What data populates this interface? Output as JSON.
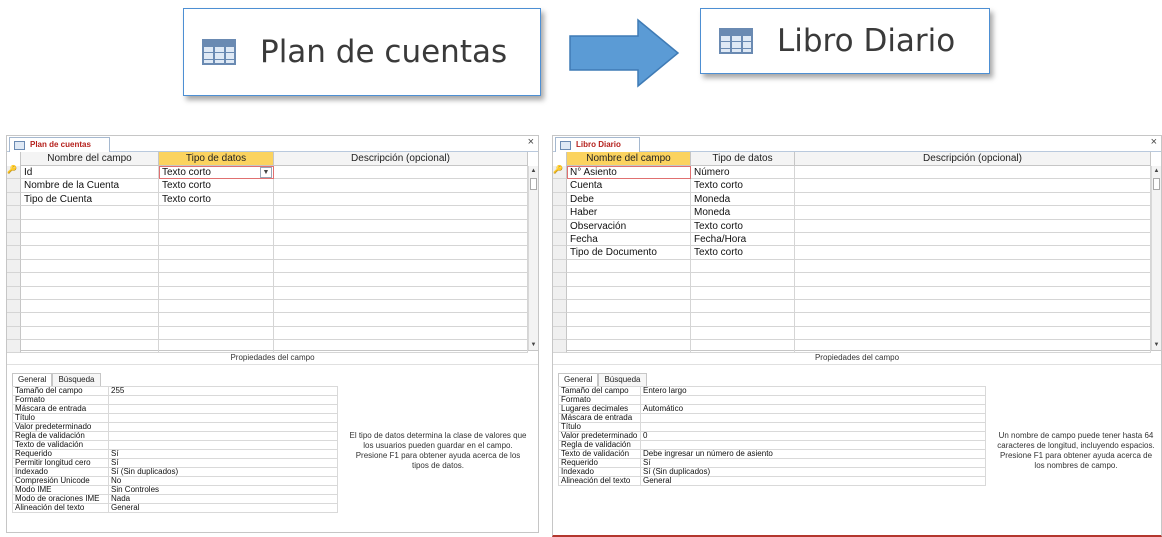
{
  "callouts": {
    "left": {
      "label": "Plan de cuentas",
      "icon": "table-icon"
    },
    "right": {
      "label": "Libro Diario",
      "icon": "table-icon"
    },
    "arrow_color": "#5b9bd5"
  },
  "left_window": {
    "tab_label": "Plan de cuentas",
    "close": "×",
    "headers": [
      "Nombre del campo",
      "Tipo de datos",
      "Descripción (opcional)"
    ],
    "rows": [
      {
        "name": "Id",
        "type": "Texto corto",
        "desc": ""
      },
      {
        "name": "Nombre de la Cuenta",
        "type": "Texto corto",
        "desc": ""
      },
      {
        "name": "Tipo de Cuenta",
        "type": "Texto corto",
        "desc": ""
      }
    ],
    "props_title": "Propiedades del campo",
    "tabs": [
      "General",
      "Búsqueda"
    ],
    "properties": [
      {
        "k": "Tamaño del campo",
        "v": "255"
      },
      {
        "k": "Formato",
        "v": ""
      },
      {
        "k": "Máscara de entrada",
        "v": ""
      },
      {
        "k": "Título",
        "v": ""
      },
      {
        "k": "Valor predeterminado",
        "v": ""
      },
      {
        "k": "Regla de validación",
        "v": ""
      },
      {
        "k": "Texto de validación",
        "v": ""
      },
      {
        "k": "Requerido",
        "v": "Sí"
      },
      {
        "k": "Permitir longitud cero",
        "v": "Sí"
      },
      {
        "k": "Indexado",
        "v": "Sí (Sin duplicados)"
      },
      {
        "k": "Compresión Unicode",
        "v": "No"
      },
      {
        "k": "Modo IME",
        "v": "Sin Controles"
      },
      {
        "k": "Modo de oraciones IME",
        "v": "Nada"
      },
      {
        "k": "Alineación del texto",
        "v": "General"
      }
    ],
    "help": "El tipo de datos determina la clase de valores que los usuarios pueden guardar en el campo. Presione F1 para obtener ayuda acerca de los tipos de datos."
  },
  "right_window": {
    "tab_label": "Libro Diario",
    "close": "×",
    "headers": [
      "Nombre del campo",
      "Tipo de datos",
      "Descripción (opcional)"
    ],
    "rows": [
      {
        "name": "N° Asiento",
        "type": "Número",
        "desc": ""
      },
      {
        "name": "Cuenta",
        "type": "Texto corto",
        "desc": ""
      },
      {
        "name": "Debe",
        "type": "Moneda",
        "desc": ""
      },
      {
        "name": "Haber",
        "type": "Moneda",
        "desc": ""
      },
      {
        "name": "Observación",
        "type": "Texto corto",
        "desc": ""
      },
      {
        "name": "Fecha",
        "type": "Fecha/Hora",
        "desc": ""
      },
      {
        "name": "Tipo de Documento",
        "type": "Texto corto",
        "desc": ""
      }
    ],
    "props_title": "Propiedades del campo",
    "tabs": [
      "General",
      "Búsqueda"
    ],
    "properties": [
      {
        "k": "Tamaño del campo",
        "v": "Entero largo"
      },
      {
        "k": "Formato",
        "v": ""
      },
      {
        "k": "Lugares decimales",
        "v": "Automático"
      },
      {
        "k": "Máscara de entrada",
        "v": ""
      },
      {
        "k": "Título",
        "v": ""
      },
      {
        "k": "Valor predeterminado",
        "v": "0"
      },
      {
        "k": "Regla de validación",
        "v": ""
      },
      {
        "k": "Texto de validación",
        "v": "Debe ingresar un número de asiento"
      },
      {
        "k": "Requerido",
        "v": "Sí"
      },
      {
        "k": "Indexado",
        "v": "Sí (Sin duplicados)"
      },
      {
        "k": "Alineación del texto",
        "v": "General"
      }
    ],
    "help": "Un nombre de campo puede tener hasta 64 caracteres de longitud, incluyendo espacios. Presione F1 para obtener ayuda acerca de los nombres de campo."
  }
}
